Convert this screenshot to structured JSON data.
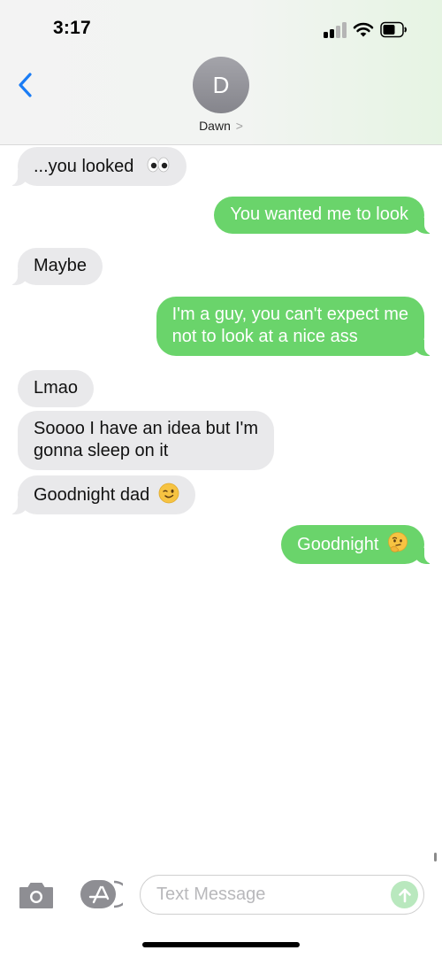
{
  "status_bar": {
    "time": "3:17",
    "signal_icon": "cellular-signal-icon",
    "wifi_icon": "wifi-icon",
    "battery_icon": "battery-icon"
  },
  "header": {
    "back_icon": "chevron-left-icon",
    "avatar_initial": "D",
    "contact_name": "Dawn",
    "contact_chevron": ">"
  },
  "messages": [
    {
      "direction": "incoming",
      "text": "...you looked",
      "emoji": "eyes"
    },
    {
      "direction": "outgoing",
      "text": "You wanted me to look"
    },
    {
      "direction": "incoming",
      "text": "Maybe"
    },
    {
      "direction": "outgoing",
      "lines": [
        "I'm a guy, you can't expect me",
        "not to look at a nice ass"
      ]
    },
    {
      "direction": "incoming",
      "text": "Lmao"
    },
    {
      "direction": "incoming",
      "lines": [
        "Soooo I have an idea but I'm",
        "gonna sleep on it"
      ]
    },
    {
      "direction": "incoming",
      "text": "Goodnight dad",
      "emoji": "winking-face"
    },
    {
      "direction": "outgoing",
      "text": "Goodnight",
      "emoji": "thinking-face"
    }
  ],
  "composer": {
    "camera_icon": "camera-icon",
    "apps_icon": "app-store-icon",
    "placeholder": "Text Message",
    "send_icon": "arrow-up-icon"
  },
  "colors": {
    "incoming_bubble": "#e9e9eb",
    "outgoing_bubble": "#6ad46b",
    "accent_blue": "#1a7cf5",
    "send_disabled": "#b9e8be"
  }
}
